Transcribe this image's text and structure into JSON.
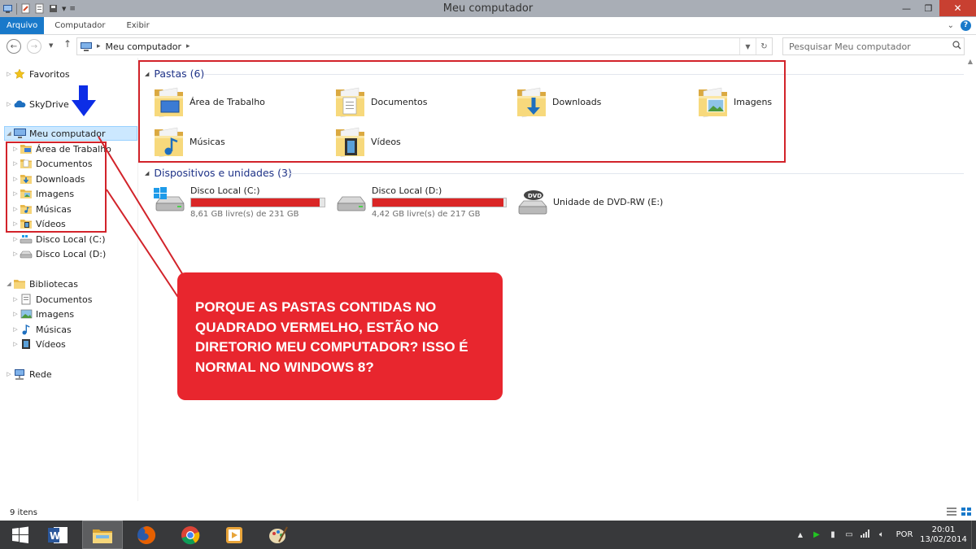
{
  "window": {
    "title": "Meu computador"
  },
  "ribbon": {
    "tabs": [
      "Arquivo",
      "Computador",
      "Exibir"
    ]
  },
  "address": {
    "path": [
      "Meu computador"
    ]
  },
  "search": {
    "placeholder": "Pesquisar Meu computador"
  },
  "nav": {
    "favoritos": "Favoritos",
    "skydrive": "SkyDrive",
    "meu_computador": "Meu computador",
    "pc_children": [
      "Área de Trabalho",
      "Documentos",
      "Downloads",
      "Imagens",
      "Músicas",
      "Vídeos",
      "Disco Local (C:)",
      "Disco Local (D:)"
    ],
    "bibliotecas": "Bibliotecas",
    "lib_children": [
      "Documentos",
      "Imagens",
      "Músicas",
      "Vídeos"
    ],
    "rede": "Rede"
  },
  "content": {
    "folders_header": "Pastas (6)",
    "folders": [
      "Área de Trabalho",
      "Documentos",
      "Downloads",
      "Imagens",
      "Músicas",
      "Vídeos"
    ],
    "devices_header": "Dispositivos e unidades (3)",
    "drives": [
      {
        "name": "Disco Local (C:)",
        "free": "8,61 GB livre(s) de 231 GB",
        "used_fraction": 0.963
      },
      {
        "name": "Disco Local (D:)",
        "free": "4,42 GB livre(s) de 217 GB",
        "used_fraction": 0.98
      }
    ],
    "dvd": "Unidade de DVD-RW (E:)"
  },
  "callout": {
    "text": "PORQUE AS PASTAS CONTIDAS NO QUADRADO VERMELHO, ESTÃO NO DIRETORIO MEU COMPUTADOR? ISSO É NORMAL NO WINDOWS 8?"
  },
  "status": {
    "items": "9 itens"
  },
  "taskbar": {
    "lang": "POR",
    "time": "20:01",
    "date": "13/02/2014"
  },
  "colors": {
    "accent": "#1979ca",
    "annotation_red": "#d2232a",
    "drive_bar": "#da2626",
    "folder_yellow": "#f2c94c"
  }
}
